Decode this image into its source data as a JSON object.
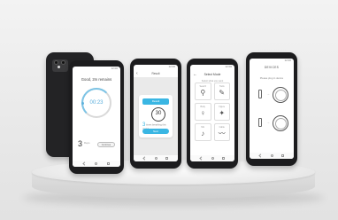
{
  "timer_screen": {
    "status_time": "12:00",
    "title": "Good, 2m remains",
    "timer": "00:23",
    "reps_count": "3",
    "reps_label": "Reps",
    "button_label": "Continue"
  },
  "result_screen": {
    "status_time": "12:00",
    "title": "Result",
    "card_header": "Result",
    "score": "30",
    "stat_value": "3",
    "stat_text": "times breathing this round",
    "button_label": "Next"
  },
  "selection_screen": {
    "status_time": "12:00",
    "title": "Select Mode",
    "subtitle": "Select what you want",
    "tiles": [
      {
        "label": "Search",
        "icon": "search-icon",
        "glyph": "⚲"
      },
      {
        "label": "Tools",
        "icon": "tools-icon",
        "glyph": "✎"
      },
      {
        "label": "Body",
        "icon": "person-icon",
        "glyph": "♀"
      },
      {
        "label": "Figure",
        "icon": "figure-icon",
        "glyph": "✦"
      },
      {
        "label": "Mic",
        "icon": "microphone-icon",
        "glyph": "♪"
      },
      {
        "label": "Cable",
        "icon": "cable-icon",
        "glyph": "〰"
      }
    ]
  },
  "devices_screen": {
    "status_time": "12:00",
    "title": "DEVICES",
    "subtitle": "Please plug in device"
  },
  "colors": {
    "accent": "#3ab6e3",
    "phone_body": "#1c1c1e",
    "background": "#efefef"
  }
}
